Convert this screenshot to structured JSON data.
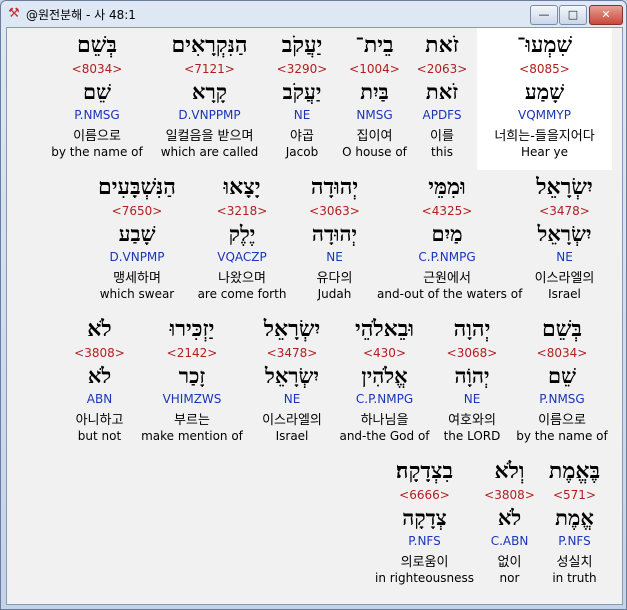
{
  "window": {
    "title": "@원전분해 - 사 48:1",
    "minimize_glyph": "—",
    "maximize_glyph": "□",
    "close_glyph": "✕"
  },
  "rows": [
    [
      {
        "hebrew": "שִׁמְעוּ־",
        "strong": "<8085>",
        "lemma": "שָׁמַע",
        "morph": "VQMMYP",
        "korean": "너희는-들을지어다",
        "english": "Hear ye"
      },
      {
        "hebrew": "זֹאת",
        "strong": "<2063>",
        "lemma": "זֹאת",
        "morph": "APDFS",
        "korean": "이를",
        "english": "this"
      },
      {
        "hebrew": "בֵית־",
        "strong": "<1004>",
        "lemma": "בַּיִת",
        "morph": "NMSG",
        "korean": "집이여",
        "english": "O house of"
      },
      {
        "hebrew": "יַעֲקֹב",
        "strong": "<3290>",
        "lemma": "יַעֲקֹב",
        "morph": "NE",
        "korean": "야곱",
        "english": "Jacob"
      },
      {
        "hebrew": "הַנִּקְרָאִים",
        "strong": "<7121>",
        "lemma": "קָרָא",
        "morph": "D.VNPPMP",
        "korean": "일컬음을 받으며",
        "english": "which are called"
      },
      {
        "hebrew": "בְּשֵׁם",
        "strong": "<8034>",
        "lemma": "שֵׁם",
        "morph": "P.NMSG",
        "korean": "이름으로",
        "english": "by the name of"
      }
    ],
    [
      {
        "hebrew": "יִשְׂרָאֵל",
        "strong": "<3478>",
        "lemma": "יִשְׂרָאֵל",
        "morph": "NE",
        "korean": "이스라엘의",
        "english": "Israel"
      },
      {
        "hebrew": "וּמִמֵּי",
        "strong": "<4325>",
        "lemma": "מַיִם",
        "morph": "C.P.NMPG",
        "korean": "근원에서",
        "english": "and-out of the waters of"
      },
      {
        "hebrew": "יְהוּדָה",
        "strong": "<3063>",
        "lemma": "יְהוּדָה",
        "morph": "NE",
        "korean": "유다의",
        "english": "Judah"
      },
      {
        "hebrew": "יָצָאוּ",
        "strong": "<3218>",
        "lemma": "יֶלֶק",
        "morph": "VQACZP",
        "korean": "나왔으며",
        "english": "are come forth"
      },
      {
        "hebrew": "הַנִּשְׁבָּעִים",
        "strong": "<7650>",
        "lemma": "שָׁבַע",
        "morph": "D.VNPMP",
        "korean": "맹세하며",
        "english": "which swear"
      }
    ],
    [
      {
        "hebrew": "בְּשֵׁם",
        "strong": "<8034>",
        "lemma": "שֵׁם",
        "morph": "P.NMSG",
        "korean": "이름으로",
        "english": "by the name of"
      },
      {
        "hebrew": "יְהוָה",
        "strong": "<3068>",
        "lemma": "יְהוָֹה",
        "morph": "NE",
        "korean": "여호와의",
        "english": "the LORD"
      },
      {
        "hebrew": "וּבֵאלֹהֵי",
        "strong": "<430>",
        "lemma": "אֱלֹהִין",
        "morph": "C.P.NMPG",
        "korean": "하나님을",
        "english": "and-the God of"
      },
      {
        "hebrew": "יִשְׂרָאֵל",
        "strong": "<3478>",
        "lemma": "יִשְׂרָאֵל",
        "morph": "NE",
        "korean": "이스라엘의",
        "english": "Israel"
      },
      {
        "hebrew": "יַזְכִּירוּ",
        "strong": "<2142>",
        "lemma": "זָכַר",
        "morph": "VHIMZWS",
        "korean": "부르는",
        "english": "make mention of"
      },
      {
        "hebrew": "לֹא",
        "strong": "<3808>",
        "lemma": "לֹא",
        "morph": "ABN",
        "korean": "아니하고",
        "english": "but not"
      }
    ],
    [
      {
        "hebrew": "בֶּאֱמֶת",
        "strong": "<571>",
        "lemma": "אֱמֶת",
        "morph": "P.NFS",
        "korean": "성실치",
        "english": "in truth"
      },
      {
        "hebrew": "וְלֹא",
        "strong": "<3808>",
        "lemma": "לֹא",
        "morph": "C.ABN",
        "korean": "없이",
        "english": "nor"
      },
      {
        "hebrew": "בִצְדָקָה׃",
        "strong": "<6666>",
        "lemma": "צְדָקָה",
        "morph": "P.NFS",
        "korean": "의로움이",
        "english": "in righteousness"
      }
    ]
  ],
  "selected_word": "0.0"
}
